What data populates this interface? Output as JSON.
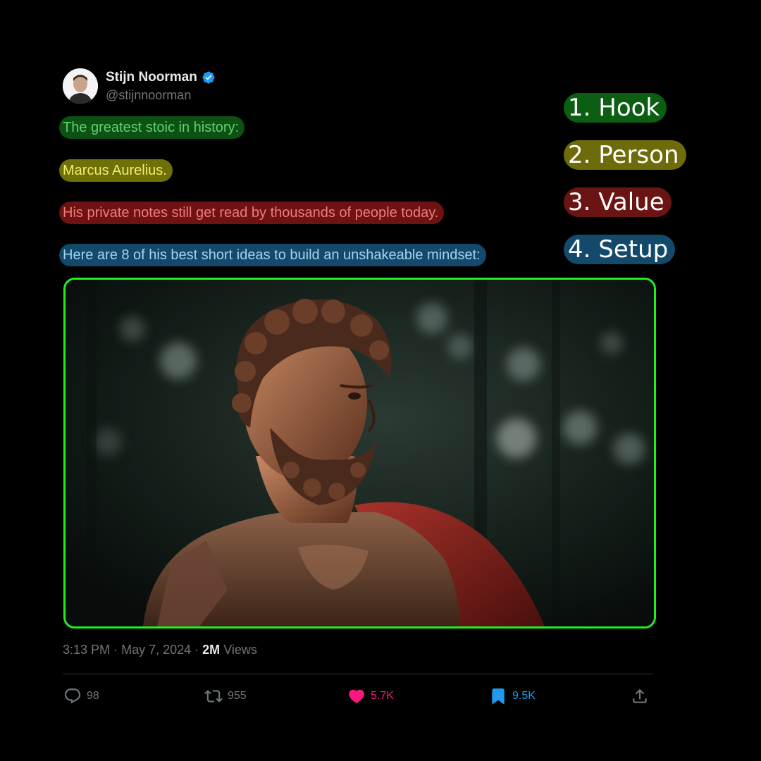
{
  "author": {
    "name": "Stijn Noorman",
    "handle": "@stijnnoorman",
    "verified": true
  },
  "tweet_lines": [
    "The greatest stoic in history:",
    "Marcus Aurelius.",
    "His private notes still get read by thousands of people today.",
    "Here are 8 of his best short ideas to build an unshakeable mindset:"
  ],
  "annotations": [
    {
      "label": "1. Hook",
      "color": "#0b5e12"
    },
    {
      "label": "2. Person",
      "color": "#6e6c0a"
    },
    {
      "label": "3. Value",
      "color": "#6b1414"
    },
    {
      "label": "4. Setup",
      "color": "#134a6b"
    }
  ],
  "media": {
    "border_color": "#22ee22"
  },
  "meta": {
    "time": "3:13 PM",
    "separator": "·",
    "date": "May 7, 2024",
    "views_count": "2M",
    "views_label": "Views"
  },
  "actions": {
    "replies": "98",
    "reposts": "955",
    "likes": "5.7K",
    "bookmarks": "9.5K"
  },
  "icons": {
    "reply": "reply-bubble-icon",
    "repost": "repost-icon",
    "like": "heart-icon",
    "bookmark": "bookmark-icon",
    "share": "share-upload-icon",
    "verified": "verified-badge-icon"
  },
  "colors": {
    "background": "#000000",
    "like": "#f91880",
    "bookmark": "#1d9bf0",
    "muted": "#71767b"
  }
}
